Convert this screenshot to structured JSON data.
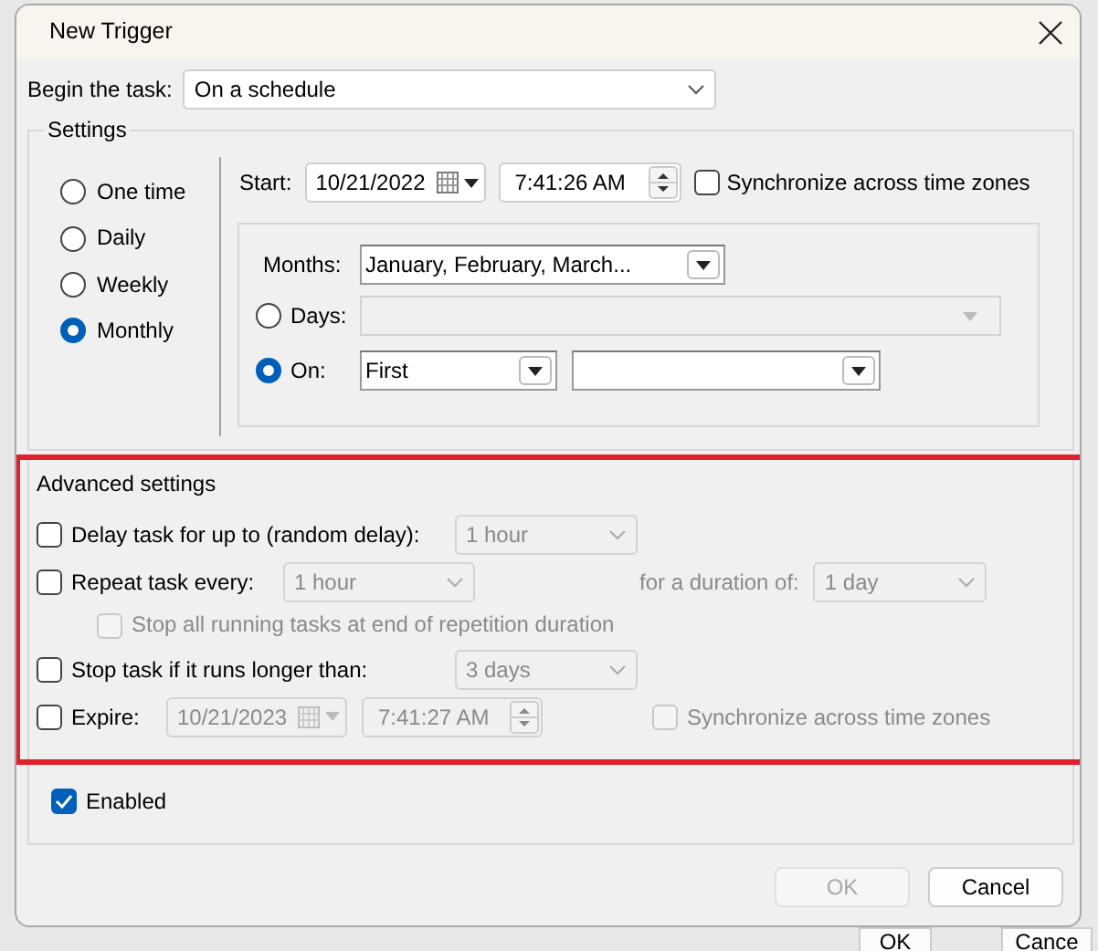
{
  "background_window": {
    "buttons": [
      "OK",
      "Cance"
    ]
  },
  "dialog": {
    "title": "New Trigger"
  },
  "begin_task": {
    "label": "Begin the task:",
    "value": "On a schedule"
  },
  "settings": {
    "title": "Settings",
    "schedule_options": [
      {
        "label": "One time",
        "selected": false
      },
      {
        "label": "Daily",
        "selected": false
      },
      {
        "label": "Weekly",
        "selected": false
      },
      {
        "label": "Monthly",
        "selected": true
      }
    ],
    "start": {
      "label": "Start:",
      "date": "10/21/2022",
      "time": "7:41:26 AM"
    },
    "sync": {
      "label": "Synchronize across time zones",
      "checked": false
    },
    "months": {
      "label": "Months:",
      "value": "January, February, March..."
    },
    "days": {
      "label": "Days:",
      "selected": false,
      "disabled": true
    },
    "on": {
      "label": "On:",
      "selected": true,
      "value": "First"
    }
  },
  "advanced": {
    "title": "Advanced settings",
    "highlighted": true,
    "delay": {
      "label": "Delay task for up to (random delay):",
      "checked": false,
      "value": "1 hour",
      "value_disabled": true
    },
    "repeat": {
      "label": "Repeat task every:",
      "checked": false,
      "value": "1 hour",
      "value_disabled": true,
      "duration_label": "for a duration of:",
      "duration": "1 day"
    },
    "stop_all": {
      "label": "Stop all running tasks at end of repetition duration",
      "checked": false,
      "disabled": true
    },
    "stop_if": {
      "label": "Stop task if it runs longer than:",
      "checked": false,
      "value": "3 days",
      "value_disabled": true
    },
    "expire": {
      "label": "Expire:",
      "checked": false,
      "date": "10/21/2023",
      "time": "7:41:27 AM",
      "value_disabled": true,
      "sync_label": "Synchronize across time zones",
      "sync_checked": false
    }
  },
  "enabled": {
    "label": "Enabled",
    "checked": true
  },
  "buttons": [
    {
      "label": "OK",
      "disabled": true
    },
    {
      "label": "Cancel",
      "disabled": false
    }
  ]
}
